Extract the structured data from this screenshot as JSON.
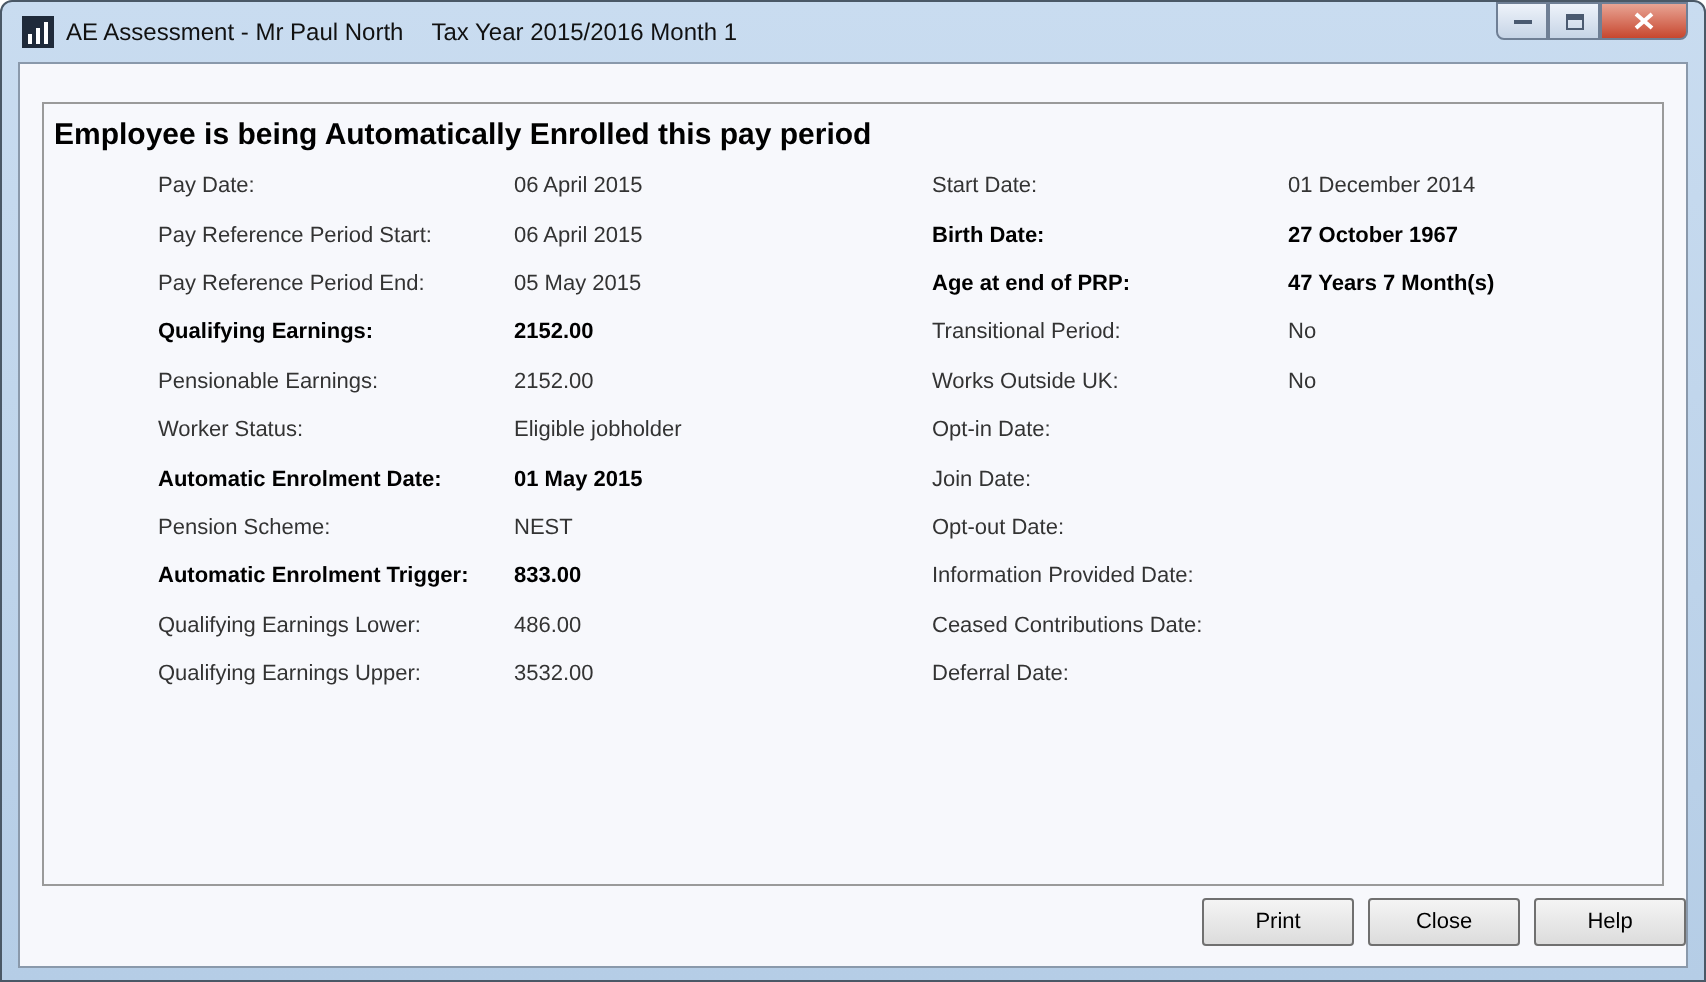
{
  "window": {
    "title": "AE Assessment - Mr Paul North",
    "subtitle": "Tax Year 2015/2016 Month 1"
  },
  "heading": "Employee is being Automatically Enrolled this pay period",
  "left_fields": [
    {
      "label": "Pay Date:",
      "value": "06 April 2015",
      "bold": false
    },
    {
      "label": "Pay Reference Period Start:",
      "value": "06 April 2015",
      "bold": false
    },
    {
      "label": "Pay Reference Period End:",
      "value": "05 May 2015",
      "bold": false
    },
    {
      "label": "Qualifying Earnings:",
      "value": "2152.00",
      "bold": true
    },
    {
      "label": "Pensionable Earnings:",
      "value": "2152.00",
      "bold": false
    },
    {
      "label": "Worker Status:",
      "value": "Eligible jobholder",
      "bold": false
    },
    {
      "label": "Automatic Enrolment Date:",
      "value": "01 May 2015",
      "bold": true
    },
    {
      "label": "Pension Scheme:",
      "value": "NEST",
      "bold": false
    },
    {
      "label": "Automatic Enrolment Trigger:",
      "value": "833.00",
      "bold": true
    },
    {
      "label": "Qualifying Earnings Lower:",
      "value": "486.00",
      "bold": false
    },
    {
      "label": "Qualifying Earnings Upper:",
      "value": "3532.00",
      "bold": false
    }
  ],
  "right_fields": [
    {
      "label": "Start Date:",
      "value": "01 December 2014",
      "bold": false
    },
    {
      "label": "Birth Date:",
      "value": "27 October 1967",
      "bold": true
    },
    {
      "label": "Age at end of PRP:",
      "value": "47 Years 7 Month(s)",
      "bold": true
    },
    {
      "label": "Transitional Period:",
      "value": "No",
      "bold": false
    },
    {
      "label": "Works Outside UK:",
      "value": "No",
      "bold": false
    },
    {
      "label": "Opt-in Date:",
      "bold": false
    },
    {
      "label": "Join Date:",
      "bold": false
    },
    {
      "label": "Opt-out Date:",
      "bold": false
    },
    {
      "label": "Information Provided Date:",
      "bold": false
    },
    {
      "label": "Ceased Contributions Date:",
      "bold": false
    },
    {
      "label": "Deferral Date:",
      "bold": false
    }
  ],
  "buttons": [
    "Print",
    "Close",
    "Help"
  ]
}
